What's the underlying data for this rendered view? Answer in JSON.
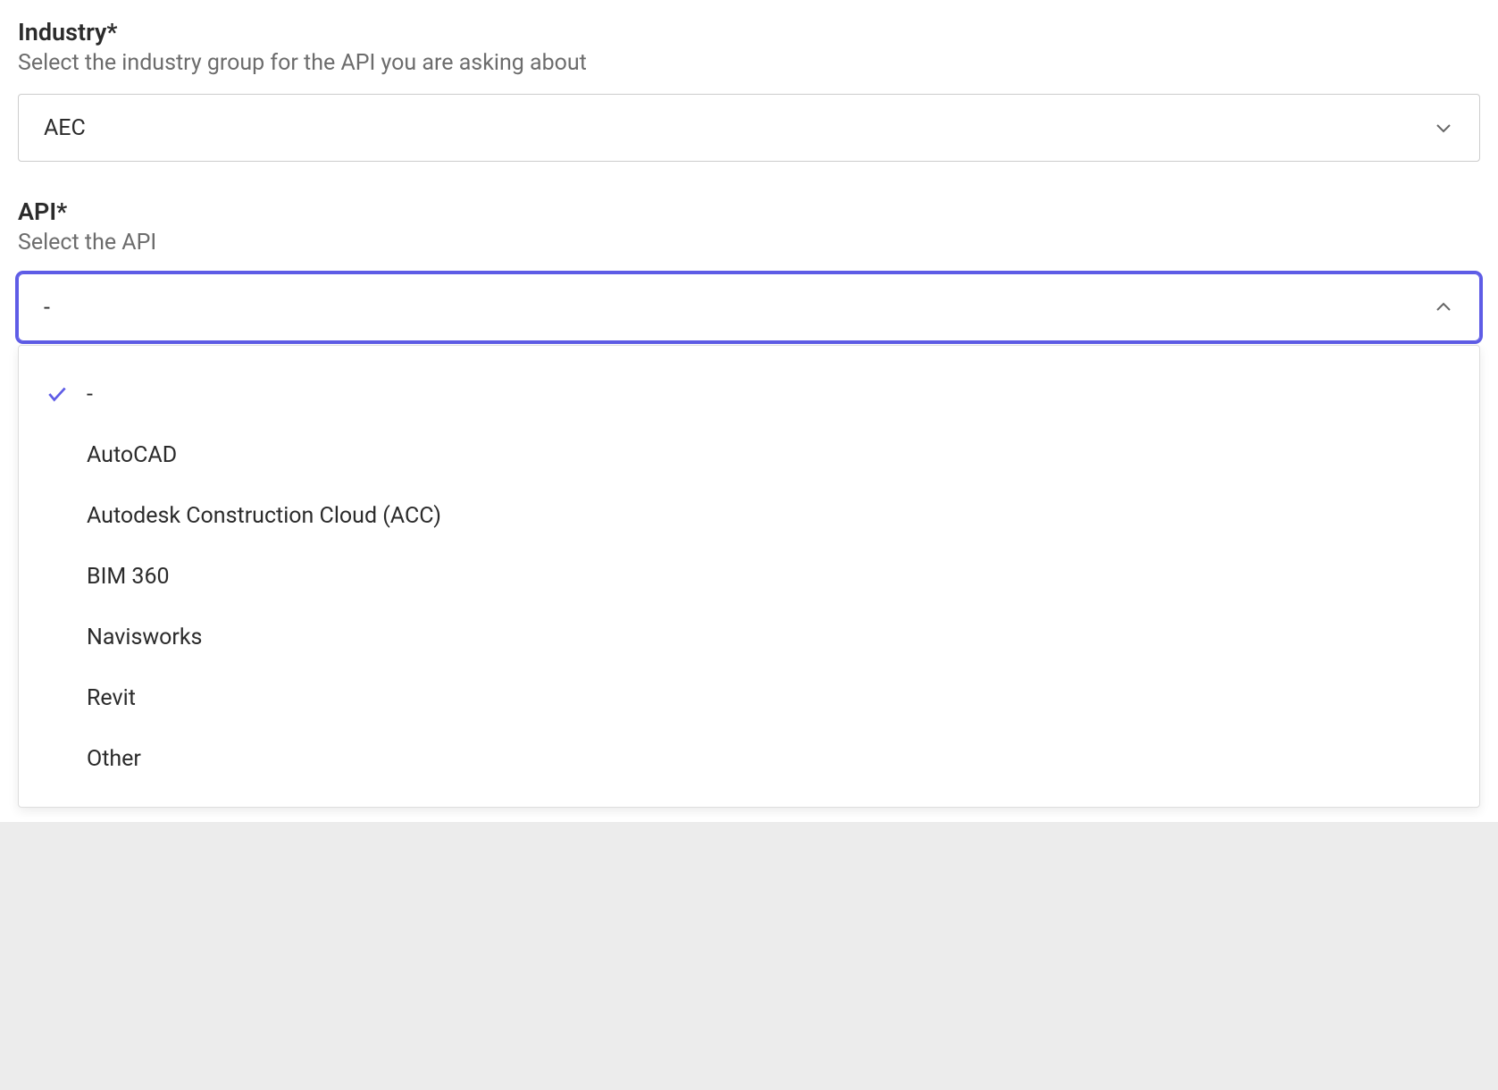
{
  "industry": {
    "label": "Industry*",
    "description": "Select the industry group for the API you are asking about",
    "selected": "AEC"
  },
  "api": {
    "label": "API*",
    "description": "Select the API",
    "selected": "-",
    "options": [
      {
        "label": "-",
        "selected": true
      },
      {
        "label": "AutoCAD",
        "selected": false
      },
      {
        "label": "Autodesk Construction Cloud (ACC)",
        "selected": false
      },
      {
        "label": "BIM 360",
        "selected": false
      },
      {
        "label": "Navisworks",
        "selected": false
      },
      {
        "label": "Revit",
        "selected": false
      },
      {
        "label": "Other",
        "selected": false
      }
    ]
  }
}
